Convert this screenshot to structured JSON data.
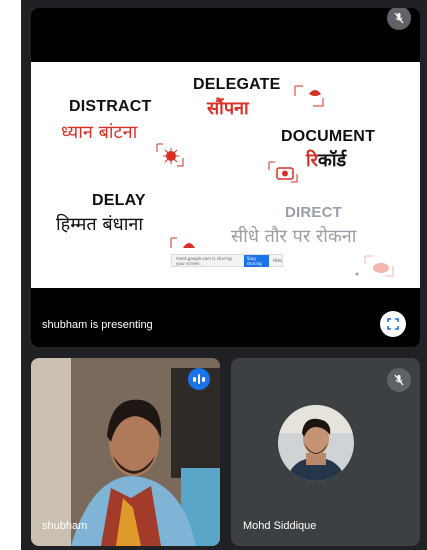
{
  "presenter_tile": {
    "label": "shubham is presenting",
    "slide": {
      "items": [
        {
          "en": "DELEGATE",
          "hi": "सौंपना"
        },
        {
          "en": "DISTRACT",
          "hi": "ध्यान बांटना"
        },
        {
          "en": "DOCUMENT",
          "hi": "रिकॉर्ड"
        },
        {
          "en": "DELAY",
          "hi": "हिम्मत बंधाना"
        },
        {
          "en": "DIRECT",
          "hi": "सीधे तौर पर रोकना"
        }
      ],
      "share_bar_text": "meet.google.com is sharing your screen.",
      "share_bar_stop": "Stop sharing",
      "share_bar_hide": "Hide"
    }
  },
  "participants": [
    {
      "name": "shubham",
      "speaking": true
    },
    {
      "name": "Mohd Siddique",
      "muted": true
    }
  ],
  "colors": {
    "background": "#202124",
    "tile": "#3c4043",
    "accent": "#1a73e8",
    "slide_red": "#d93025"
  },
  "icons": {
    "mic_off": "mic-off-icon",
    "fullscreen": "fullscreen-icon",
    "speaking": "speaking-indicator-icon"
  }
}
